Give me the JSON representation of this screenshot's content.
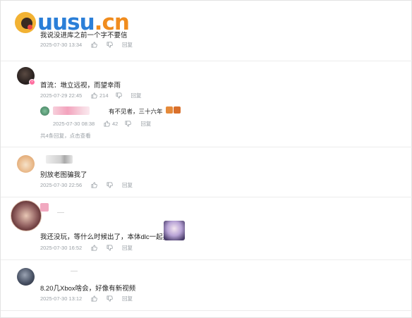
{
  "logo": {
    "brand_1": "uusu",
    "brand_dot": ".",
    "brand_2": "cn"
  },
  "actions": {
    "reply_label": "回复",
    "like_icon": "thumbs-up-icon",
    "dislike_icon": "thumbs-down-icon"
  },
  "comments": [
    {
      "text": "我说没进库之前一个字不要信",
      "time": "2025-07-30 13:34",
      "likes": ""
    },
    {
      "text": "首流：墩立远视，而望幸雨",
      "time": "2025-07-29 22:45",
      "likes": "214",
      "reply": {
        "text": "有不见者，三十六年",
        "time": "2025-07-30 08:38",
        "likes": "42"
      },
      "more_replies": "共4条回复，点击查看"
    },
    {
      "text": "别放老图骗我了",
      "time": "2025-07-30 22:56",
      "likes": ""
    },
    {
      "text": "我还没玩，等什么时候出了，本体dlc一起买",
      "time": "2025-07-30 16:52",
      "likes": ""
    },
    {
      "text": "8.20几Xbox啥会，好像有新视频",
      "time": "2025-07-30 13:12",
      "likes": ""
    }
  ],
  "colors": {
    "accent_blue": "#2b7fd8",
    "accent_orange": "#f08c1e",
    "meta_gray": "#9aa0a6",
    "divider": "#ececec"
  }
}
